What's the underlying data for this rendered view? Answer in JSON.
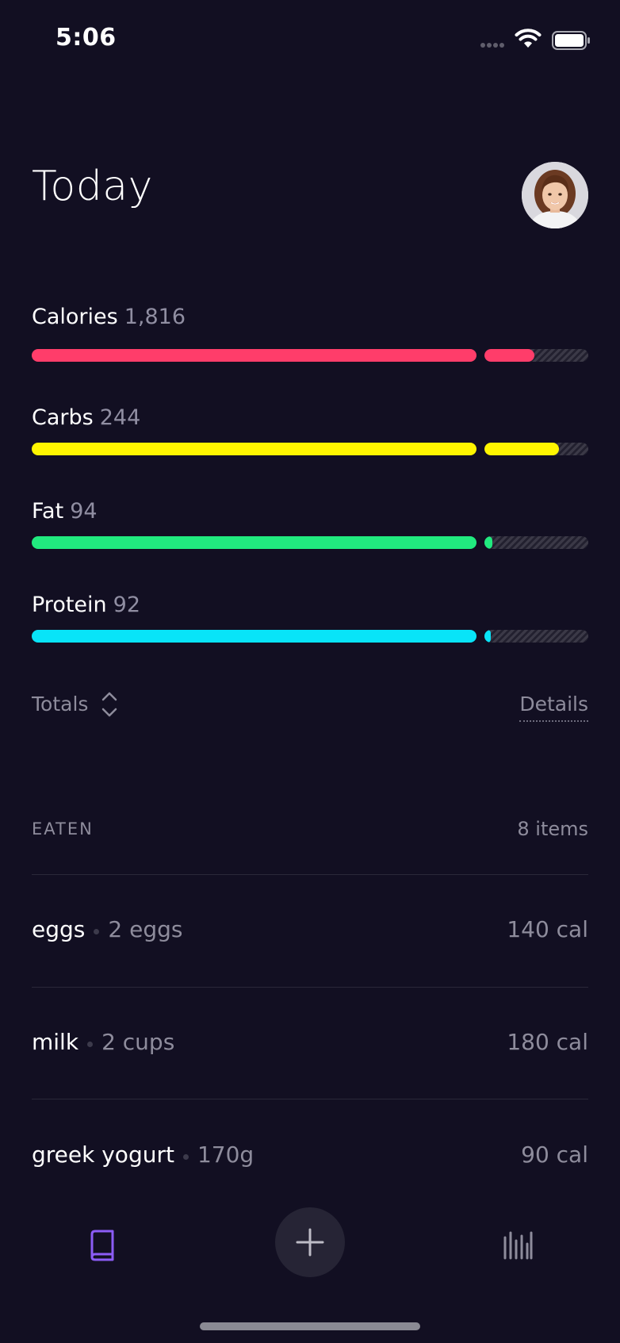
{
  "status_bar": {
    "time": "5:06"
  },
  "header": {
    "title": "Today"
  },
  "macros": [
    {
      "label": "Calories",
      "value": "1,816",
      "color": "#ff3d6a",
      "bonus_fill": 0.48
    },
    {
      "label": "Carbs",
      "value": "244",
      "color": "#fff500",
      "bonus_fill": 0.72
    },
    {
      "label": "Fat",
      "value": "94",
      "color": "#21ea7f",
      "bonus_fill": 0.08
    },
    {
      "label": "Protein",
      "value": "92",
      "color": "#08e4f8",
      "bonus_fill": 0.04
    }
  ],
  "totals": {
    "label": "Totals",
    "details_link": "Details"
  },
  "eaten": {
    "title": "EATEN",
    "count": "8 items",
    "items": [
      {
        "name": "eggs",
        "quantity": "2 eggs",
        "calories": "140 cal"
      },
      {
        "name": "milk",
        "quantity": "2 cups",
        "calories": "180 cal"
      },
      {
        "name": "greek yogurt",
        "quantity": "170g",
        "calories": "90 cal"
      }
    ]
  },
  "tab_bar": {
    "icons": [
      "book-icon",
      "plus-icon",
      "stats-icon"
    ],
    "active_color": "#8c5cf6",
    "inactive_color": "#8e8c9c"
  }
}
